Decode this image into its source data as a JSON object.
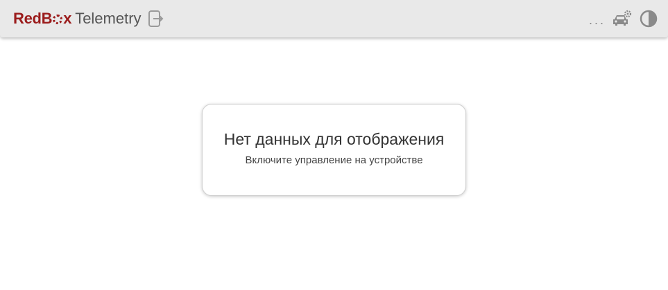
{
  "header": {
    "brand_part1": "RedB",
    "brand_part2": "x",
    "brand_part3": "Telemetry",
    "brand_color": "#9b1c1c",
    "menu_label": "...",
    "icons": [
      "logout-icon",
      "car-settings-icon",
      "theme-toggle-icon"
    ]
  },
  "message": {
    "title": "Нет данных для отображения",
    "subtitle": "Включите управление на устройстве"
  }
}
